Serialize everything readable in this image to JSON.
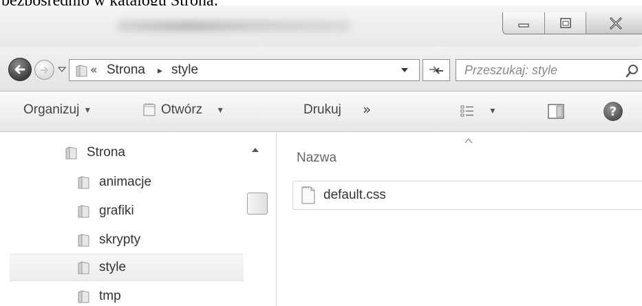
{
  "caption": "bezpośrednio w katalogu Strona:",
  "window": {
    "buttons": {
      "minimize": "minimize-icon",
      "maximize": "maximize-icon",
      "close": "close-icon"
    }
  },
  "address": {
    "overflow": "«",
    "breadcrumbs": [
      "Strona",
      "style"
    ],
    "separator": "▸"
  },
  "search": {
    "placeholder": "Przeszukaj: style"
  },
  "toolbar": {
    "organize": "Organizuj",
    "open": "Otwórz",
    "print": "Drukuj",
    "more": "»"
  },
  "tree": {
    "root": "Strona",
    "children": [
      "animacje",
      "grafiki",
      "skrypty",
      "style",
      "tmp"
    ],
    "selected": "style"
  },
  "list": {
    "column_name": "Nazwa",
    "files": [
      "default.css"
    ]
  },
  "colors": {
    "selection": "#ececec",
    "border": "#8e8e8e",
    "placeholder": "#8a8a8a"
  }
}
